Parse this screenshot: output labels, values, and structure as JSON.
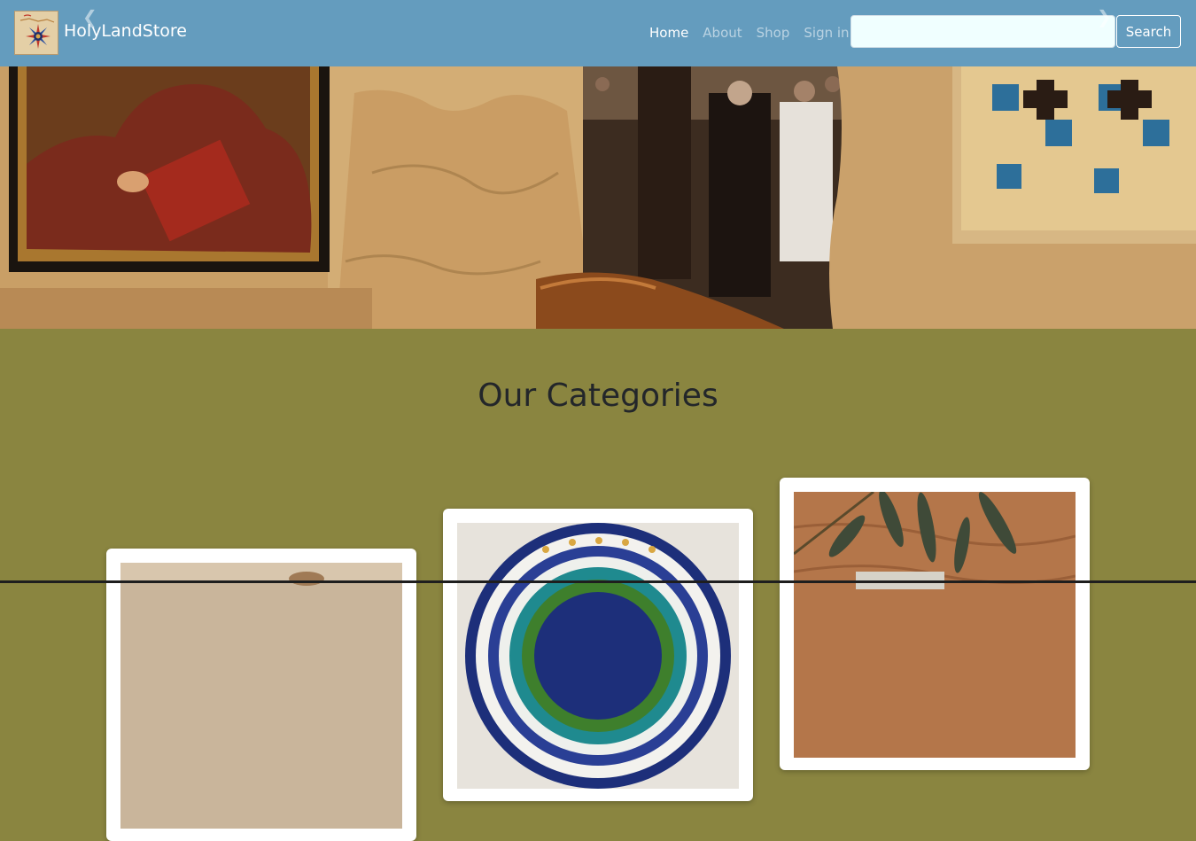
{
  "navbar": {
    "brand_name": "HolyLandStore",
    "links": [
      {
        "label": "Home",
        "active": true
      },
      {
        "label": "About",
        "active": false
      },
      {
        "label": "Shop",
        "active": false
      },
      {
        "label": "Sign in",
        "active": false
      }
    ],
    "search_placeholder": "",
    "search_button": "Search",
    "background_color": "#649cbe"
  },
  "carousel": {
    "prev_icon": "chevron-left-icon",
    "next_icon": "chevron-right-icon"
  },
  "categories": {
    "title": "Our Categories",
    "background_color": "#8a8540",
    "cards": [
      {
        "image": "olive-wood-craft-photo"
      },
      {
        "image": "armenian-ceramic-plate-photo"
      },
      {
        "image": "olive-leaves-on-wood-photo"
      }
    ]
  }
}
